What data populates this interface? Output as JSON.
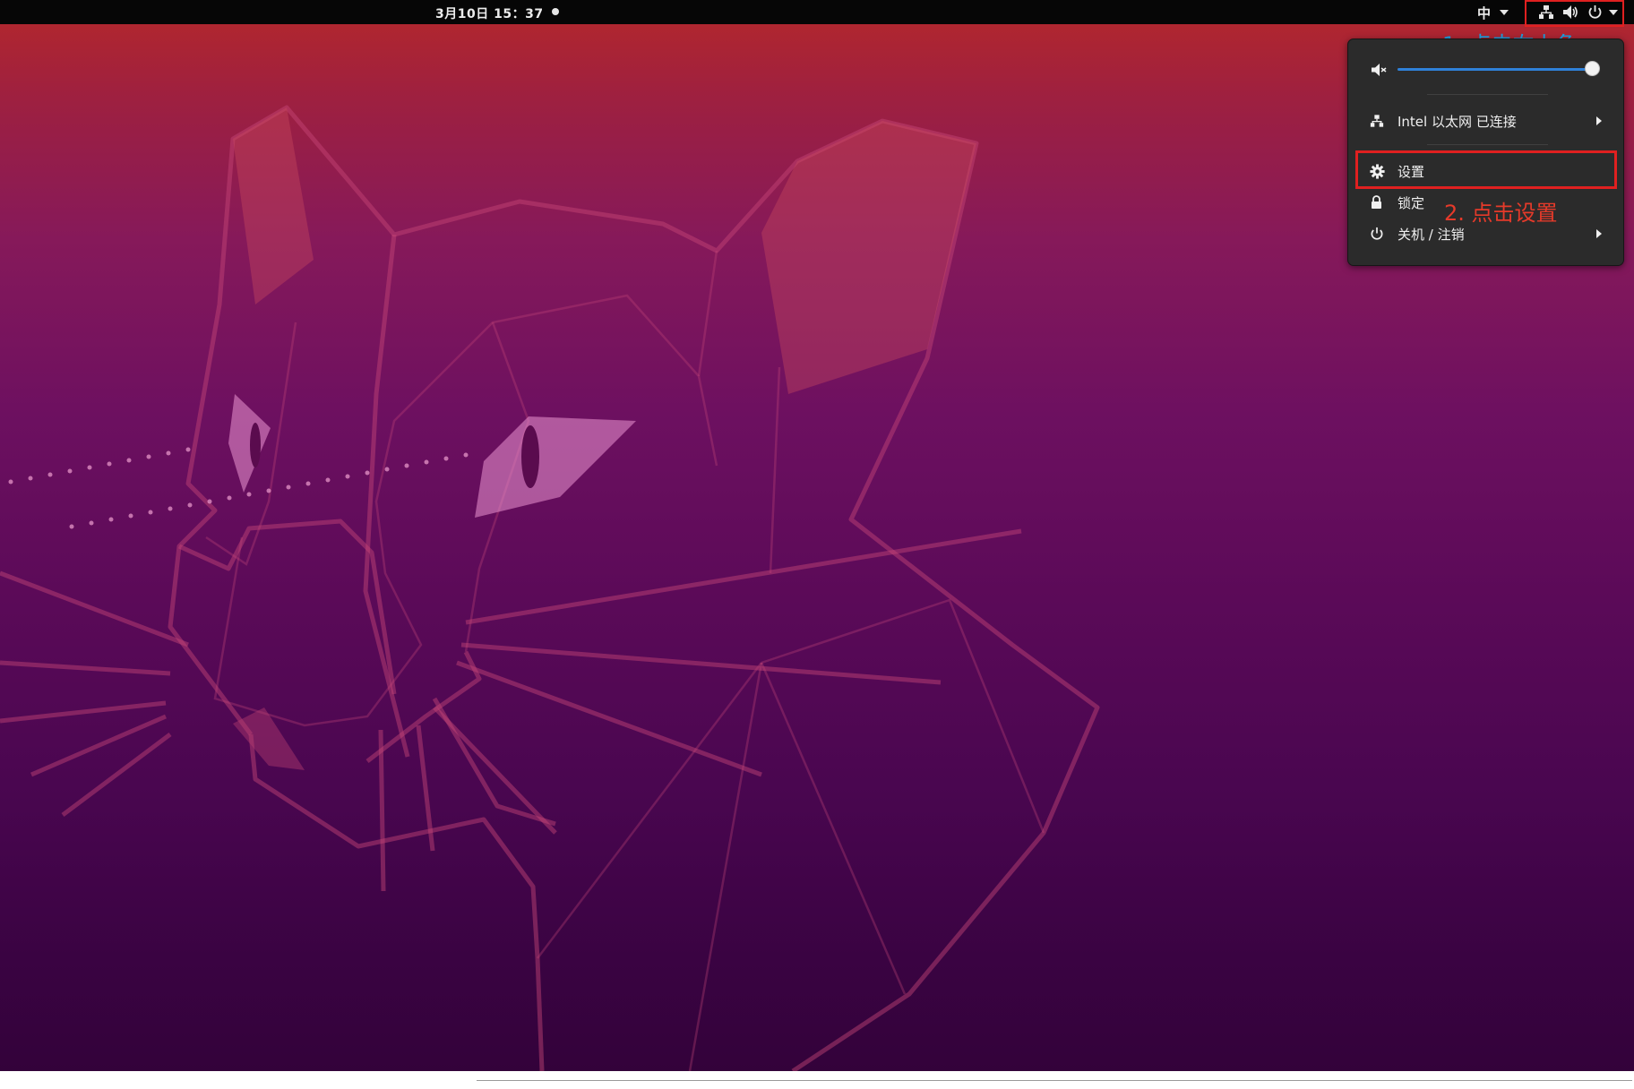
{
  "topbar": {
    "clock": "3月10日 15：37",
    "input_method": "中",
    "tray_icons": [
      "network-wired-icon",
      "volume-icon",
      "power-icon",
      "chevron-down-icon"
    ]
  },
  "annotations": {
    "step1": "1. 点击右上角",
    "step2": "2. 点击设置",
    "step1_color": "#1ba1e2",
    "step2_color": "#e53a2a",
    "box_color": "#e02020"
  },
  "system_menu": {
    "volume": {
      "icon": "volume-muted-icon",
      "level": 1.0
    },
    "network": {
      "label": "Intel 以太网 已连接",
      "icon": "network-wired-icon"
    },
    "settings": {
      "label": "设置",
      "icon": "gear-icon"
    },
    "lock": {
      "label": "锁定",
      "icon": "lock-icon"
    },
    "power": {
      "label": "关机 / 注销",
      "icon": "power-icon"
    }
  },
  "colors": {
    "topbar": "#060606",
    "menu_bg": "#2b2b2b",
    "accent": "#2f81d9",
    "wallpaper_top": "#b5282a",
    "wallpaper_bottom": "#320239"
  }
}
